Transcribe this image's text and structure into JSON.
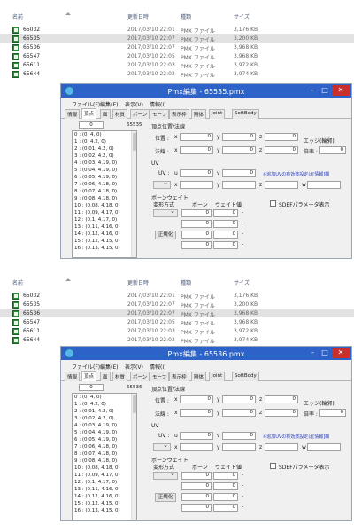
{
  "file_list": {
    "headers": {
      "name": "名前",
      "date": "更新日時",
      "type": "種類",
      "size": "サイズ"
    },
    "rows": [
      {
        "name": "65032",
        "date": "2017/03/10 22:01",
        "type": "PMX ファイル",
        "size": "3,176 KB"
      },
      {
        "name": "65535",
        "date": "2017/03/10 22:07",
        "type": "PMX ファイル",
        "size": "3,200 KB"
      },
      {
        "name": "65536",
        "date": "2017/03/10 22:07",
        "type": "PMX ファイル",
        "size": "3,968 KB"
      },
      {
        "name": "65547",
        "date": "2017/03/10 22:05",
        "type": "PMX ファイル",
        "size": "3,968 KB"
      },
      {
        "name": "65611",
        "date": "2017/03/10 22:03",
        "type": "PMX ファイル",
        "size": "3,972 KB"
      },
      {
        "name": "65644",
        "date": "2017/03/10 22:02",
        "type": "PMX ファイル",
        "size": "3,974 KB"
      }
    ]
  },
  "panels": [
    {
      "selected_row": 1,
      "window_title": "Pmx編集 - 65535.pmx",
      "vertex_count": "65535"
    },
    {
      "selected_row": 2,
      "window_title": "Pmx編集 - 65536.pmx",
      "vertex_count": "65536"
    }
  ],
  "editor": {
    "menu": [
      "ファイル(F)",
      "編集(E)",
      "表示(V)",
      "情報(I)"
    ],
    "tabs": [
      "情報",
      "頂点",
      "面",
      "材質",
      "ボーン",
      "モーフ",
      "表示枠",
      "剛体",
      "Joint",
      "SoftBody"
    ],
    "active_tab": "頂点",
    "index_value": "0",
    "vertices": [
      "0 : (0, 4, 0)",
      "1 : (0, 4.2, 0)",
      "2 : (0.01, 4.2, 0)",
      "3 : (0.02, 4.2, 0)",
      "4 : (0.03, 4.19, 0)",
      "5 : (0.04, 4.19, 0)",
      "6 : (0.05, 4.19, 0)",
      "7 : (0.06, 4.18, 0)",
      "8 : (0.07, 4.18, 0)",
      "9 : (0.08, 4.18, 0)",
      "10 : (0.08, 4.18, 0)",
      "11 : (0.09, 4.17, 0)",
      "12 : (0.1, 4.17, 0)",
      "13 : (0.11, 4.16, 0)",
      "14 : (0.12, 4.16, 0)",
      "15 : (0.12, 4.15, 0)",
      "16 : (0.13, 4.15, 0)"
    ],
    "section_pos_normal": "頂点位置/法線",
    "label_position": "位置 :",
    "label_normal": "法線 :",
    "label_x": "x",
    "label_y": "y",
    "label_z": "z",
    "label_w": "w",
    "label_u": "u",
    "label_v": "v",
    "zero": "0",
    "edge_label": "エッジ(輪郭)",
    "scale_label": "倍率 :",
    "scale_value": "0",
    "uv_section": "UV",
    "uv_label": "UV :",
    "uv_hint": "※追加UVの有効数設定は[情報]欄",
    "bone_weight_section": "ボーンウェイト",
    "deform_label": "変形方式",
    "bone_label": "ボーン",
    "weight_label": "ウェイト値",
    "sdef_label": "SDEFパラメータ表示",
    "normalize_button": "正規化"
  }
}
